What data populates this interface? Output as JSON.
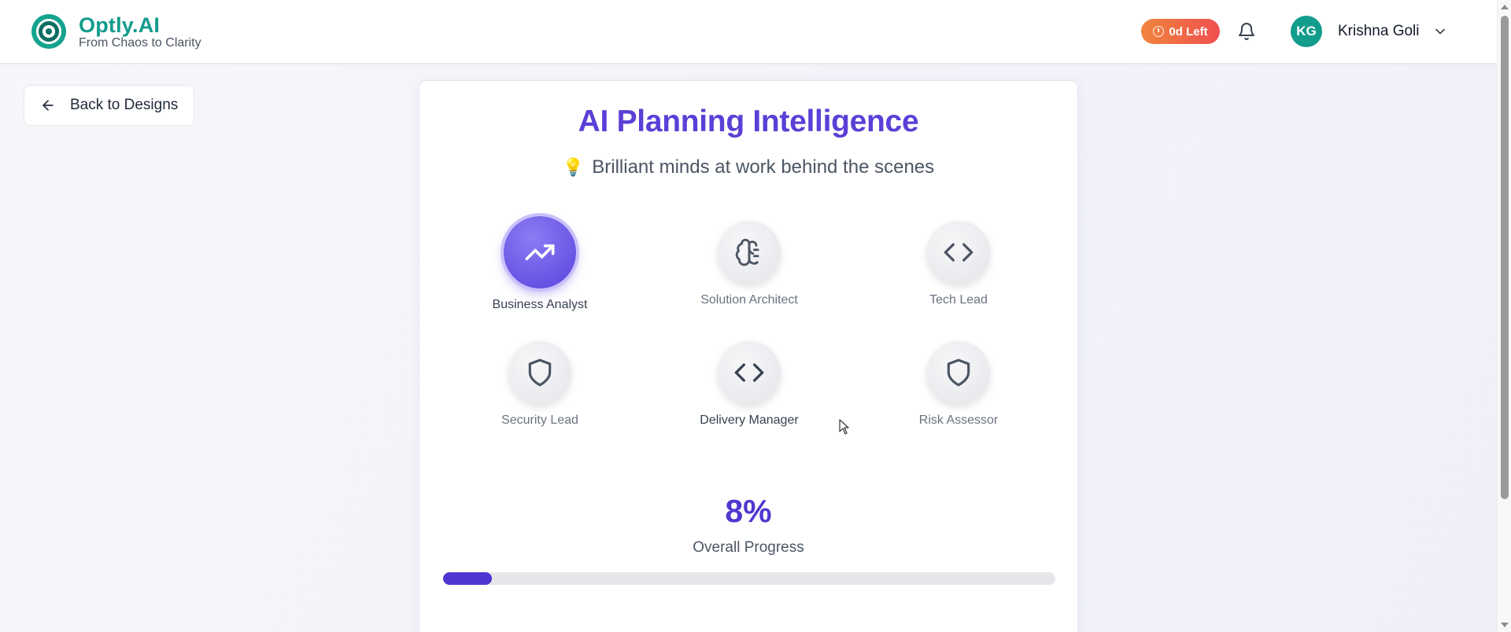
{
  "header": {
    "brand_name": "Optly.AI",
    "tagline": "From Chaos to Clarity",
    "days_left": "0d Left",
    "user_initials": "KG",
    "user_name": "Krishna Goli"
  },
  "back_button": {
    "label": "Back to Designs"
  },
  "card": {
    "title": "AI Planning Intelligence",
    "subtitle": "Brilliant minds at work behind the scenes",
    "agents": [
      {
        "label": "Business Analyst",
        "icon": "trending-up-icon",
        "active": true
      },
      {
        "label": "Solution Architect",
        "icon": "brain-icon",
        "active": false
      },
      {
        "label": "Tech Lead",
        "icon": "code-icon",
        "active": false
      },
      {
        "label": "Security Lead",
        "icon": "shield-icon",
        "active": false
      },
      {
        "label": "Delivery Manager",
        "icon": "code-icon",
        "active": false
      },
      {
        "label": "Risk Assessor",
        "icon": "shield-icon",
        "active": false
      }
    ],
    "progress": {
      "value_text": "8%",
      "label": "Overall Progress",
      "percent": 8
    }
  },
  "colors": {
    "brand": "#129c8c",
    "accent": "#5b3fd6",
    "badge_start": "#f0853d",
    "badge_end": "#ef4f4f"
  }
}
